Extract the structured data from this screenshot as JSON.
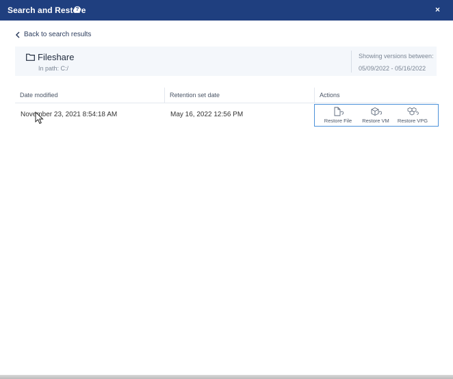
{
  "dialog": {
    "title": "Search and Restore",
    "help_icon": "help-circle-icon",
    "close_label": "×"
  },
  "back_link": {
    "label": "Back to search results",
    "icon": "chevron-left-icon"
  },
  "item": {
    "icon": "folder-icon",
    "name": "Fileshare",
    "path": "In path:  C:/",
    "versions_label": "Showing versions between:",
    "versions_range": "05/09/2022 - 05/16/2022"
  },
  "table": {
    "columns": [
      "Date modified",
      "Retention set date",
      "Actions"
    ],
    "rows": [
      {
        "date_modified": "November 23, 2021 8:54:18 AM",
        "retention_set_date": "May 16, 2022 12:56 PM"
      }
    ]
  },
  "actions": [
    {
      "label": "Restore File",
      "icon": "restore-file-icon"
    },
    {
      "label": "Restore VM",
      "icon": "restore-vm-icon"
    },
    {
      "label": "Restore VPG",
      "icon": "restore-vpg-icon"
    }
  ],
  "colors": {
    "titlebar": "#1f3f7f",
    "accent_border": "#4a90d9",
    "info_panel": "#f4f7fb"
  }
}
